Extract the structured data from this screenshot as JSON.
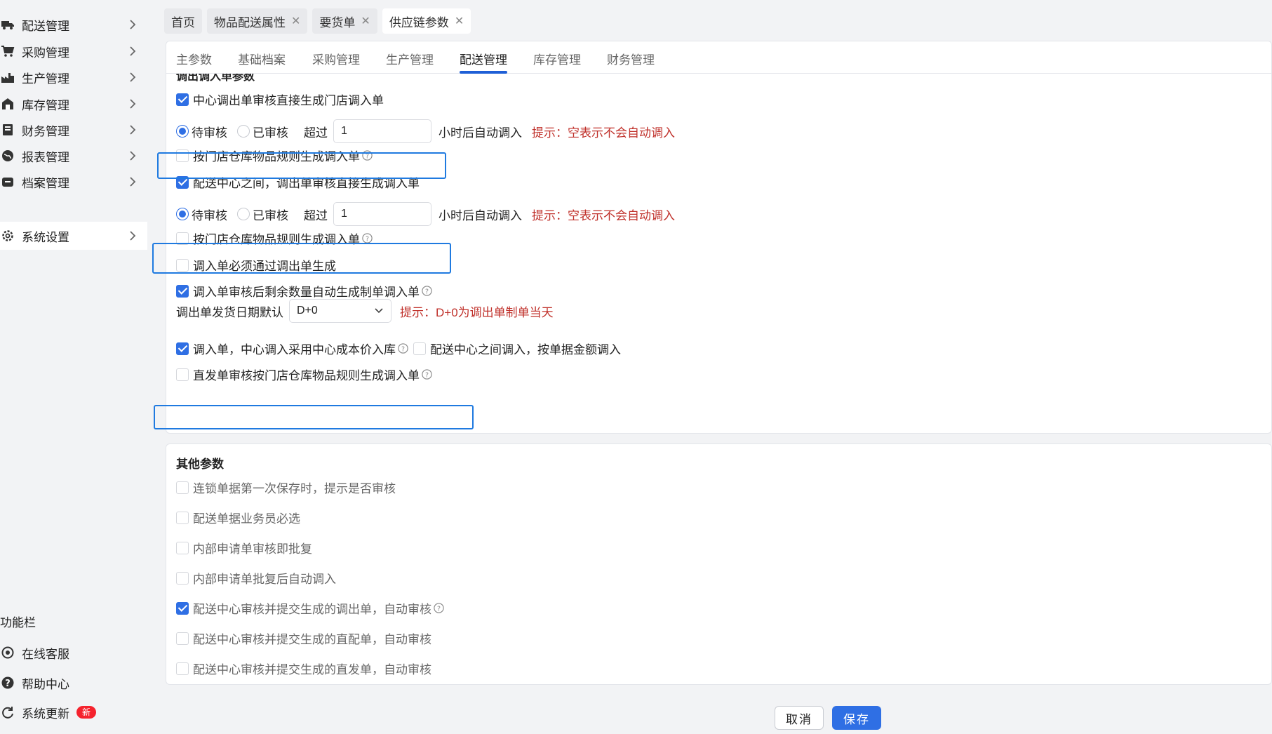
{
  "sidebar": {
    "items": [
      {
        "label": "配送管理",
        "icon": "truck-icon"
      },
      {
        "label": "采购管理",
        "icon": "cart-icon"
      },
      {
        "label": "生产管理",
        "icon": "factory-icon"
      },
      {
        "label": "库存管理",
        "icon": "warehouse-icon"
      },
      {
        "label": "财务管理",
        "icon": "ledger-icon"
      },
      {
        "label": "报表管理",
        "icon": "globe-icon"
      },
      {
        "label": "档案管理",
        "icon": "archive-icon"
      },
      {
        "label": "系统设置",
        "icon": "gear-icon"
      }
    ],
    "section_title": "功能栏",
    "function_items": [
      {
        "label": "在线客服",
        "icon": "headset-icon"
      },
      {
        "label": "帮助中心",
        "icon": "question-icon"
      },
      {
        "label": "系统更新",
        "icon": "refresh-icon",
        "badge": "新"
      }
    ]
  },
  "tabs": [
    {
      "label": "首页"
    },
    {
      "label": "物品配送属性"
    },
    {
      "label": "要货单"
    },
    {
      "label": "供应链参数"
    }
  ],
  "subtabs": [
    "主参数",
    "基础档案",
    "采购管理",
    "生产管理",
    "配送管理",
    "库存管理",
    "财务管理"
  ],
  "active_subtab": "配送管理",
  "panel1": {
    "cut_title": "调出调入单参数",
    "row1": "中心调出单审核直接生成门店调入单",
    "radio_pending": "待审核",
    "radio_approved": "已审核",
    "exceed": "超过",
    "hours_value": "1",
    "hours_suffix": "小时后自动调入",
    "hint_empty": "提示：空表示不会自动调入",
    "row3": "按门店仓库物品规则生成调入单",
    "row4": "配送中心之间，调出单审核直接生成调入单",
    "row6": "按门店仓库物品规则生成调入单",
    "row7": "调入单必须通过调出单生成",
    "row8": "调入单审核后剩余数量自动生成制单调入单",
    "row9_label": "调出单发货日期默认",
    "row9_value": "D+0",
    "row9_hint": "提示：D+0为调出单制单当天",
    "row10a": "调入单，中心调入采用中心成本价入库",
    "row10b": "配送中心之间调入，按单据金额调入",
    "row11": "直发单审核按门店仓库物品规则生成调入单"
  },
  "panel2": {
    "title": "其他参数",
    "items": [
      "连锁单据第一次保存时，提示是否审核",
      "配送单据业务员必选",
      "内部申请单审核即批复",
      "内部申请单批复后自动调入",
      "配送中心审核并提交生成的调出单，自动审核",
      "配送中心审核并提交生成的直配单，自动审核",
      "配送中心审核并提交生成的直发单，自动审核"
    ]
  },
  "buttons": {
    "cancel": "取消",
    "save": "保存"
  },
  "colors": {
    "accent": "#2f6fe4",
    "hint": "#c0312b",
    "highlight": "#1f7ae0",
    "badge": "#f5222d"
  }
}
